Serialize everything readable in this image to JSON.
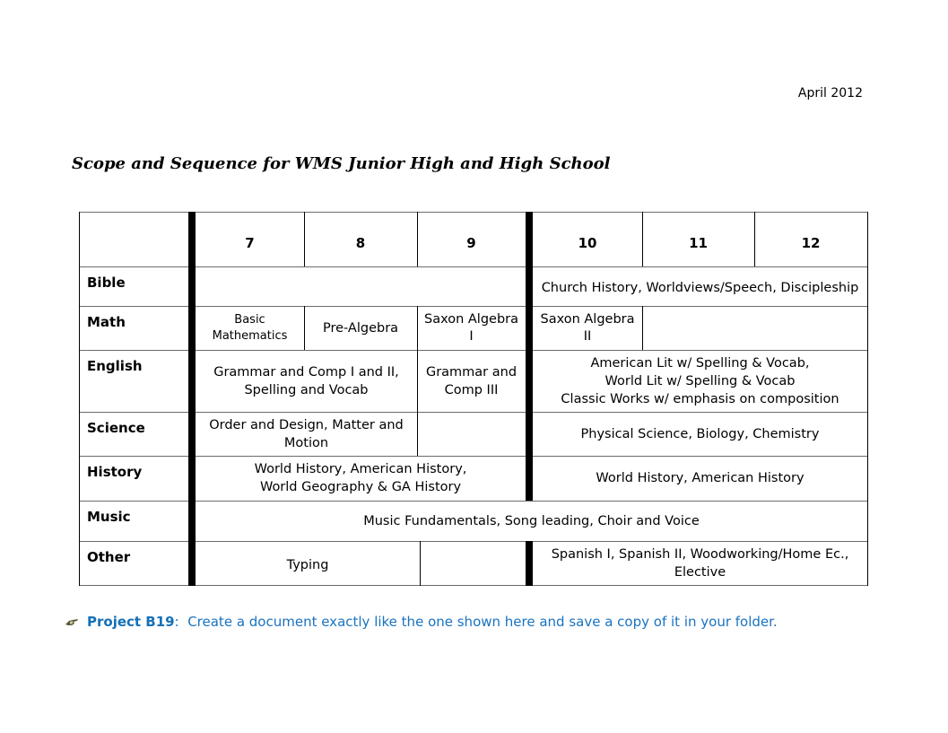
{
  "document": {
    "date": "April 2012",
    "title": "Scope and Sequence for WMS Junior High and High School"
  },
  "table": {
    "header": {
      "corner": "",
      "grades": [
        "7",
        "8",
        "9",
        "10",
        "11",
        "12"
      ]
    },
    "rows": {
      "bible": {
        "label": "Bible",
        "jr_high": "",
        "high_school": "Church History, Worldviews/Speech, Discipleship"
      },
      "math": {
        "label": "Math",
        "grade7": "Basic\nMathematics",
        "grade8": "Pre-Algebra",
        "grade9": "Saxon Algebra I",
        "grade10": "Saxon Algebra II",
        "grade11_12": ""
      },
      "english": {
        "label": "English",
        "grade7_8": "Grammar and Comp I and II, Spelling and Vocab",
        "grade9": "Grammar and Comp III",
        "high_school": "American Lit w/ Spelling & Vocab,\nWorld Lit w/ Spelling & Vocab\nClassic Works w/ emphasis on composition"
      },
      "science": {
        "label": "Science",
        "grade7_8": "Order and Design, Matter and Motion",
        "grade9": "",
        "high_school": "Physical Science, Biology, Chemistry"
      },
      "history": {
        "label": "History",
        "jr_high": "World History, American History,\nWorld Geography & GA History",
        "high_school": "World History, American History"
      },
      "music": {
        "label": "Music",
        "all_grades": "Music Fundamentals, Song leading, Choir and Voice"
      },
      "other": {
        "label": "Other",
        "grade7_8": "Typing",
        "grade9": "",
        "high_school": "Spanish I, Spanish II, Woodworking/Home Ec., Elective"
      }
    }
  },
  "note": {
    "icon": "pointing-hand-icon",
    "lead": "Project B19",
    "separator": ":  ",
    "text": "Create a document exactly like the one shown here and save a copy of it in your folder."
  },
  "colors": {
    "note_text": "#1a73c0",
    "note_lead": "#1470b8",
    "grid_line": "#6b6b6b",
    "divider": "#000000"
  }
}
